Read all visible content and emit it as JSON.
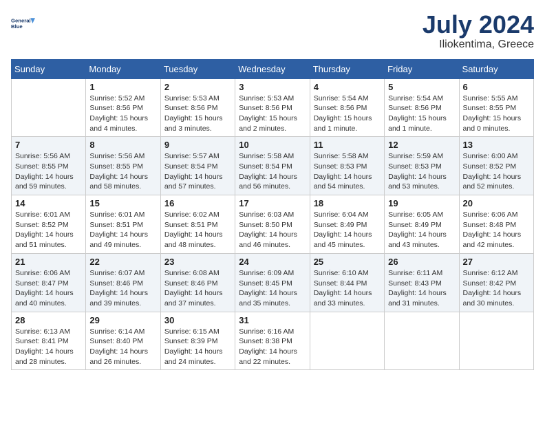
{
  "header": {
    "logo_line1": "General",
    "logo_line2": "Blue",
    "month": "July 2024",
    "location": "Iliokentima, Greece"
  },
  "weekdays": [
    "Sunday",
    "Monday",
    "Tuesday",
    "Wednesday",
    "Thursday",
    "Friday",
    "Saturday"
  ],
  "weeks": [
    [
      {
        "day": "",
        "info": ""
      },
      {
        "day": "1",
        "info": "Sunrise: 5:52 AM\nSunset: 8:56 PM\nDaylight: 15 hours\nand 4 minutes."
      },
      {
        "day": "2",
        "info": "Sunrise: 5:53 AM\nSunset: 8:56 PM\nDaylight: 15 hours\nand 3 minutes."
      },
      {
        "day": "3",
        "info": "Sunrise: 5:53 AM\nSunset: 8:56 PM\nDaylight: 15 hours\nand 2 minutes."
      },
      {
        "day": "4",
        "info": "Sunrise: 5:54 AM\nSunset: 8:56 PM\nDaylight: 15 hours\nand 1 minute."
      },
      {
        "day": "5",
        "info": "Sunrise: 5:54 AM\nSunset: 8:56 PM\nDaylight: 15 hours\nand 1 minute."
      },
      {
        "day": "6",
        "info": "Sunrise: 5:55 AM\nSunset: 8:55 PM\nDaylight: 15 hours\nand 0 minutes."
      }
    ],
    [
      {
        "day": "7",
        "info": "Sunrise: 5:56 AM\nSunset: 8:55 PM\nDaylight: 14 hours\nand 59 minutes."
      },
      {
        "day": "8",
        "info": "Sunrise: 5:56 AM\nSunset: 8:55 PM\nDaylight: 14 hours\nand 58 minutes."
      },
      {
        "day": "9",
        "info": "Sunrise: 5:57 AM\nSunset: 8:54 PM\nDaylight: 14 hours\nand 57 minutes."
      },
      {
        "day": "10",
        "info": "Sunrise: 5:58 AM\nSunset: 8:54 PM\nDaylight: 14 hours\nand 56 minutes."
      },
      {
        "day": "11",
        "info": "Sunrise: 5:58 AM\nSunset: 8:53 PM\nDaylight: 14 hours\nand 54 minutes."
      },
      {
        "day": "12",
        "info": "Sunrise: 5:59 AM\nSunset: 8:53 PM\nDaylight: 14 hours\nand 53 minutes."
      },
      {
        "day": "13",
        "info": "Sunrise: 6:00 AM\nSunset: 8:52 PM\nDaylight: 14 hours\nand 52 minutes."
      }
    ],
    [
      {
        "day": "14",
        "info": "Sunrise: 6:01 AM\nSunset: 8:52 PM\nDaylight: 14 hours\nand 51 minutes."
      },
      {
        "day": "15",
        "info": "Sunrise: 6:01 AM\nSunset: 8:51 PM\nDaylight: 14 hours\nand 49 minutes."
      },
      {
        "day": "16",
        "info": "Sunrise: 6:02 AM\nSunset: 8:51 PM\nDaylight: 14 hours\nand 48 minutes."
      },
      {
        "day": "17",
        "info": "Sunrise: 6:03 AM\nSunset: 8:50 PM\nDaylight: 14 hours\nand 46 minutes."
      },
      {
        "day": "18",
        "info": "Sunrise: 6:04 AM\nSunset: 8:49 PM\nDaylight: 14 hours\nand 45 minutes."
      },
      {
        "day": "19",
        "info": "Sunrise: 6:05 AM\nSunset: 8:49 PM\nDaylight: 14 hours\nand 43 minutes."
      },
      {
        "day": "20",
        "info": "Sunrise: 6:06 AM\nSunset: 8:48 PM\nDaylight: 14 hours\nand 42 minutes."
      }
    ],
    [
      {
        "day": "21",
        "info": "Sunrise: 6:06 AM\nSunset: 8:47 PM\nDaylight: 14 hours\nand 40 minutes."
      },
      {
        "day": "22",
        "info": "Sunrise: 6:07 AM\nSunset: 8:46 PM\nDaylight: 14 hours\nand 39 minutes."
      },
      {
        "day": "23",
        "info": "Sunrise: 6:08 AM\nSunset: 8:46 PM\nDaylight: 14 hours\nand 37 minutes."
      },
      {
        "day": "24",
        "info": "Sunrise: 6:09 AM\nSunset: 8:45 PM\nDaylight: 14 hours\nand 35 minutes."
      },
      {
        "day": "25",
        "info": "Sunrise: 6:10 AM\nSunset: 8:44 PM\nDaylight: 14 hours\nand 33 minutes."
      },
      {
        "day": "26",
        "info": "Sunrise: 6:11 AM\nSunset: 8:43 PM\nDaylight: 14 hours\nand 31 minutes."
      },
      {
        "day": "27",
        "info": "Sunrise: 6:12 AM\nSunset: 8:42 PM\nDaylight: 14 hours\nand 30 minutes."
      }
    ],
    [
      {
        "day": "28",
        "info": "Sunrise: 6:13 AM\nSunset: 8:41 PM\nDaylight: 14 hours\nand 28 minutes."
      },
      {
        "day": "29",
        "info": "Sunrise: 6:14 AM\nSunset: 8:40 PM\nDaylight: 14 hours\nand 26 minutes."
      },
      {
        "day": "30",
        "info": "Sunrise: 6:15 AM\nSunset: 8:39 PM\nDaylight: 14 hours\nand 24 minutes."
      },
      {
        "day": "31",
        "info": "Sunrise: 6:16 AM\nSunset: 8:38 PM\nDaylight: 14 hours\nand 22 minutes."
      },
      {
        "day": "",
        "info": ""
      },
      {
        "day": "",
        "info": ""
      },
      {
        "day": "",
        "info": ""
      }
    ]
  ]
}
